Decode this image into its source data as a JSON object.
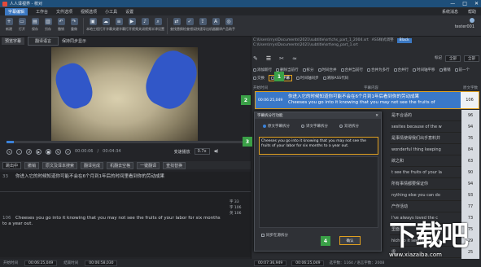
{
  "window": {
    "title": "人人译视界 - 校对",
    "controls": [
      "—",
      "□",
      "✕"
    ]
  },
  "menubar": {
    "items": [
      "字幕编辑",
      "工作台",
      "文件选项",
      "视频选项",
      "小工具",
      "设置"
    ],
    "right": [
      "系统消息",
      "帮助"
    ],
    "user": "tester001"
  },
  "toolbar": {
    "buttons": [
      {
        "icon": "new-file-icon",
        "glyph": "+",
        "label": "新建"
      },
      {
        "icon": "open-icon",
        "glyph": "▭",
        "label": "打开"
      },
      {
        "icon": "save-icon",
        "glyph": "▤",
        "label": "保存"
      },
      {
        "icon": "save-as-icon",
        "glyph": "▥",
        "label": "另存"
      },
      {
        "icon": "undo-icon",
        "glyph": "↶",
        "label": "撤销"
      },
      {
        "icon": "redo-icon",
        "glyph": "↷",
        "label": "重做"
      },
      {
        "icon": "workspace-icon",
        "glyph": "▣",
        "label": "本地工程"
      },
      {
        "icon": "cloud-icon",
        "glyph": "☁",
        "label": "打开字幕"
      },
      {
        "icon": "sub-icon",
        "glyph": "≡",
        "label": "关键字幕"
      },
      {
        "icon": "video-icon",
        "glyph": "▶",
        "label": "打开视频"
      },
      {
        "icon": "audio-icon",
        "glyph": "♪",
        "label": "关闭视频"
      },
      {
        "icon": "find-icon",
        "glyph": "⌕",
        "label": "半译设置"
      },
      {
        "icon": "replace-icon",
        "glyph": "⇄",
        "label": "查找替换"
      },
      {
        "icon": "check-icon",
        "glyph": "✓",
        "label": "检查错误"
      },
      {
        "icon": "export-icon",
        "glyph": "⇪",
        "label": "快速导出"
      },
      {
        "icon": "translate-icon",
        "glyph": "A",
        "label": "机器翻译"
      },
      {
        "icon": "product-icon",
        "glyph": "◎",
        "label": "产品助手"
      }
    ]
  },
  "video_panel": {
    "tab": "预览字幕",
    "dropdown": "翻译语言",
    "sync": "保持同步显示",
    "time_current": "00:00:06",
    "time_total": "00:04:34",
    "speed_label": "变速播放",
    "speed_value": "0.7x"
  },
  "timeline_bar": {
    "mode": "跳出中",
    "buttons": [
      "撤销",
      "原文及译本搜索",
      "翻译完成",
      "机翻去空格",
      "一键翻译",
      "查找替换"
    ]
  },
  "editor": {
    "lines": [
      {
        "num": "33",
        "text": "你进入它的时候知道你可能不会在6个月到1年后的时间里看到你的劳动成果"
      },
      {
        "num": "106",
        "text": "Cheeses you go into it knowing that you may not see the fruits of your labor for six months to a year out."
      }
    ],
    "side": [
      "字 33",
      "字 106",
      "英 106"
    ]
  },
  "status_left": {
    "start_label": "开始时间",
    "start": "00:06:25,049",
    "end_label": "结束时间",
    "end": "00:06:58,030"
  },
  "right_panel": {
    "paths": [
      "C:\\Users\\rrys\\Documents\\2021\\subtitle\\srt\\chs_part_1_2004.srt",
      "C:\\Users\\rrys\\Documents\\2021\\subtitle\\srt\\eng_part_1.srt"
    ],
    "ass_label": "ASS样式调整",
    "ass_value": "Black",
    "filter_label": "标记",
    "filter_value": "全部",
    "row1": [
      "添加新行",
      "删除当前行",
      "拆分",
      "时间合并",
      "合并当前行",
      "合并为多行",
      "合并行",
      "时间轴平移",
      "撤销",
      "前一个"
    ],
    "row2": [
      "添加新行",
      "删除当前行",
      "拆分字幕",
      "时间轴平移",
      "插入",
      "重新排序",
      "清除ASS代码"
    ],
    "split_button": "拆分字幕",
    "row3": [
      "交换",
      "拆分字幕",
      "时间轴同步",
      "清除ASS代码"
    ],
    "headers": [
      "开始时间",
      "字幕内容",
      "原文字数"
    ],
    "selected_row": {
      "time": "00:06:25,049",
      "chs": "你进入它的时候知道你可能不会在6个月到1年后看到你的劳动成果",
      "eng": "Cheeses you go into it knowing that you may not see the fruits of",
      "count": "106"
    },
    "rows": [
      {
        "text": "是不合适的",
        "count": "96"
      },
      {
        "text": "sesites because of the w",
        "count": "94"
      },
      {
        "text": "是事情使得我们出乎意料并",
        "count": "76"
      },
      {
        "text": "wonderful thing keeping",
        "count": "84"
      },
      {
        "text": "欲之和",
        "count": "63"
      },
      {
        "text": "t see the fruits of your la",
        "count": "90"
      },
      {
        "text": "所有事情都要保证你",
        "count": "94"
      },
      {
        "text": "nything else you can do",
        "count": "93"
      },
      {
        "text": "产作活动",
        "count": "77"
      },
      {
        "text": "I've always loved the c",
        "count": "73"
      },
      {
        "text": "里面",
        "count": "75"
      },
      {
        "text": "hich so it seemed like a",
        "count": "29"
      },
      {
        "text": "很",
        "count": "25"
      },
      {
        "text": "better the milk for bette",
        "count": "34"
      }
    ]
  },
  "dialog": {
    "title": "字幕拆分行功能",
    "close": "✕",
    "modes": [
      "原文字幕拆分",
      "译文字幕拆分",
      "双语拆分"
    ],
    "text": "Cheeses you go into it knowing that you may not see the fruits of your labor for six months to a year out.",
    "checkbox": "同步在源拆分",
    "ok": "确认"
  },
  "status_right": {
    "a": "00:07:36,949",
    "b": "00:06:25,049",
    "count": "选字数：1164 / 语言字数：2008"
  },
  "callouts": [
    "1",
    "2",
    "3",
    "4"
  ],
  "watermark": {
    "big": "下载吧",
    "url": "www.xiazaiba.com"
  },
  "colors": {
    "accent": "#3b78c2",
    "highlight": "#e0a020",
    "callout": "#3aa047"
  }
}
